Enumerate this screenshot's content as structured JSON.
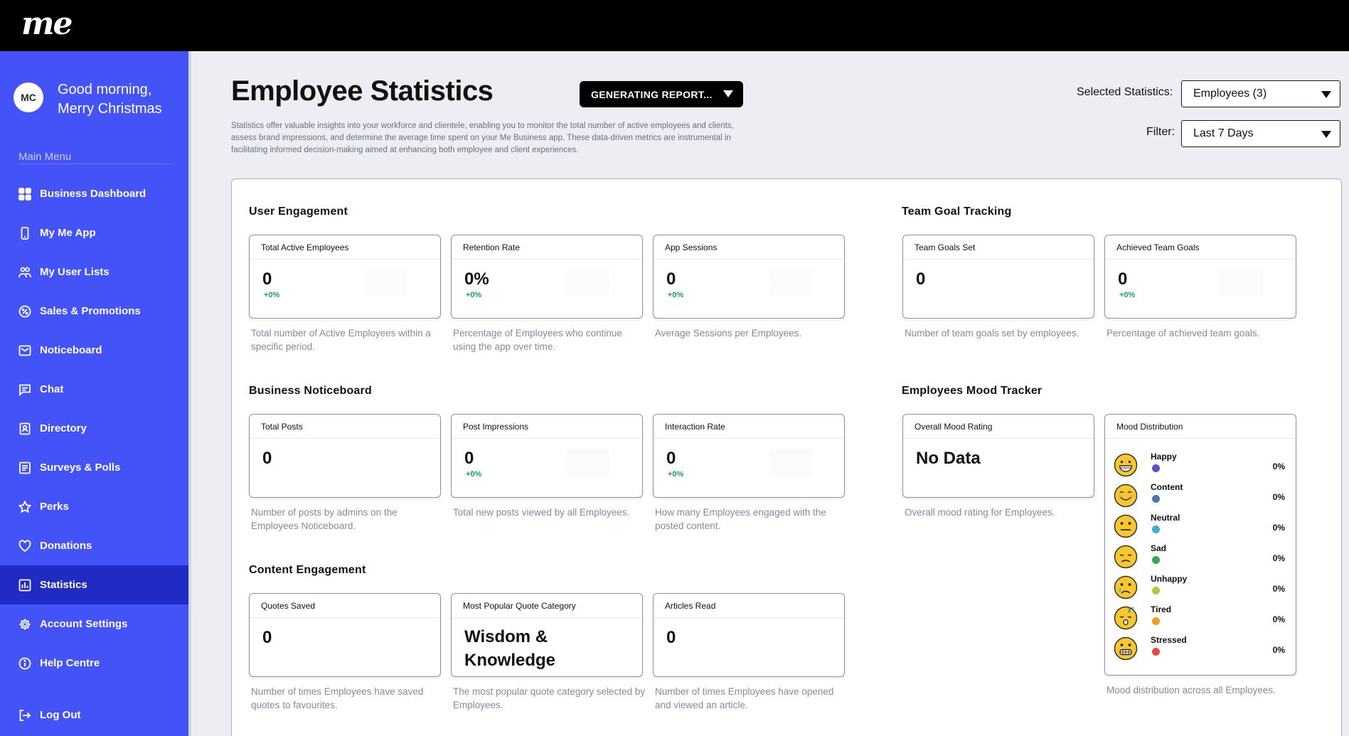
{
  "app": {
    "logo": "me"
  },
  "user": {
    "initials": "MC",
    "greeting_line1": "Good morning,",
    "greeting_line2": "Merry Christmas"
  },
  "sidebar": {
    "menu_title": "Main Menu",
    "items": [
      {
        "label": "Business Dashboard",
        "icon": "grid-icon"
      },
      {
        "label": "My Me App",
        "icon": "phone-icon"
      },
      {
        "label": "My User Lists",
        "icon": "users-icon"
      },
      {
        "label": "Sales & Promotions",
        "icon": "percent-icon"
      },
      {
        "label": "Noticeboard",
        "icon": "noticeboard-icon"
      },
      {
        "label": "Chat",
        "icon": "chat-icon"
      },
      {
        "label": "Directory",
        "icon": "directory-icon"
      },
      {
        "label": "Surveys & Polls",
        "icon": "survey-icon"
      },
      {
        "label": "Perks",
        "icon": "star-icon"
      },
      {
        "label": "Donations",
        "icon": "heart-icon"
      },
      {
        "label": "Statistics",
        "icon": "chart-icon",
        "active": true
      },
      {
        "label": "Account Settings",
        "icon": "gear-icon"
      },
      {
        "label": "Help Centre",
        "icon": "info-icon"
      },
      {
        "label": "Log Out",
        "icon": "logout-icon"
      }
    ]
  },
  "header": {
    "title": "Employee Statistics",
    "report_button": "GENERATING REPORT...",
    "intro": "Statistics offer valuable insights into your workforce and clientele, enabling you to monitor the total number of active employees and clients, assess brand impressions, and determine the average time spent on your Me Business app. These data-driven metrics are instrumental in facilitating informed decision-making aimed at enhancing both employee and client experiences.",
    "selected_label": "Selected Statistics:",
    "selected_value": "Employees (3)",
    "filter_label": "Filter:",
    "filter_value": "Last 7 Days"
  },
  "sections": {
    "user_engagement": {
      "title": "User Engagement",
      "cards": [
        {
          "title": "Total Active Employees",
          "value": "0",
          "delta": "+0%",
          "desc": "Total number of Active Employees within a specific period."
        },
        {
          "title": "Retention Rate",
          "value": "0%",
          "delta": "+0%",
          "desc": "Percentage of Employees who continue using the app over time."
        },
        {
          "title": "App Sessions",
          "value": "0",
          "delta": "+0%",
          "desc": "Average Sessions per Employees."
        }
      ]
    },
    "team_goal": {
      "title": "Team Goal Tracking",
      "cards": [
        {
          "title": "Team Goals Set",
          "value": "0",
          "desc": "Number of team goals set by employees."
        },
        {
          "title": "Achieved Team Goals",
          "value": "0",
          "delta": "+0%",
          "desc": "Percentage of achieved team goals."
        }
      ]
    },
    "noticeboard": {
      "title": "Business Noticeboard",
      "cards": [
        {
          "title": "Total Posts",
          "value": "0",
          "desc": "Number of posts by admins on the Employees Noticeboard."
        },
        {
          "title": "Post Impressions",
          "value": "0",
          "delta": "+0%",
          "desc": "Total new posts viewed by all Employees."
        },
        {
          "title": "Interaction Rate",
          "value": "0",
          "delta": "+0%",
          "desc": "How many Employees engaged with the posted content."
        }
      ]
    },
    "mood": {
      "title": "Employees Mood Tracker",
      "overall": {
        "title": "Overall Mood Rating",
        "value": "No Data",
        "desc": "Overall mood rating for Employees."
      },
      "distribution": {
        "title": "Mood Distribution",
        "desc": "Mood distribution across all Employees.",
        "rows": [
          {
            "name": "Happy",
            "pct": "0%",
            "color": "#5b4fc4",
            "face": "grin"
          },
          {
            "name": "Content",
            "pct": "0%",
            "color": "#4a73b8",
            "face": "smile"
          },
          {
            "name": "Neutral",
            "pct": "0%",
            "color": "#3fb0c9",
            "face": "neutral"
          },
          {
            "name": "Sad",
            "pct": "0%",
            "color": "#33a853",
            "face": "sad"
          },
          {
            "name": "Unhappy",
            "pct": "0%",
            "color": "#b6c63b",
            "face": "cry"
          },
          {
            "name": "Tired",
            "pct": "0%",
            "color": "#f39a1f",
            "face": "tired"
          },
          {
            "name": "Stressed",
            "pct": "0%",
            "color": "#e14b43",
            "face": "grimace"
          }
        ]
      }
    },
    "content": {
      "title": "Content Engagement",
      "cards": [
        {
          "title": "Quotes Saved",
          "value": "0",
          "desc": "Number of times Employees have saved quotes to favourites."
        },
        {
          "title": "Most Popular Quote Category",
          "value": "Wisdom & Knowledge",
          "desc": "The most popular quote category selected by Employees."
        },
        {
          "title": "Articles Read",
          "value": "0",
          "desc": "Number of times Employees have opened and viewed an article."
        }
      ]
    }
  }
}
